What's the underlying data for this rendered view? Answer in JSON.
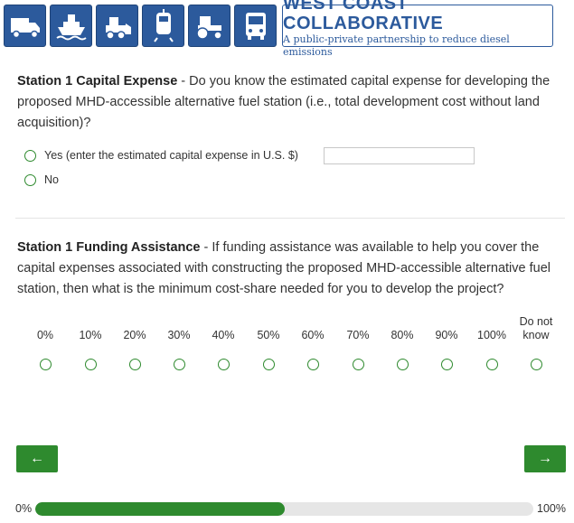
{
  "header": {
    "icons": [
      "truck-icon",
      "ship-icon",
      "loader-icon",
      "train-icon",
      "tractor-icon",
      "bus-icon"
    ],
    "logo_title": "WEST COAST COLLABORATIVE",
    "logo_subtitle": "A public-private partnership to reduce diesel emissions"
  },
  "question1": {
    "title": "Station 1 Capital Expense",
    "text": " - Do you know the estimated capital expense for developing the proposed MHD-accessible alternative fuel station (i.e., total development cost without land acquisition)?",
    "options": [
      {
        "label": "Yes (enter the estimated capital expense in U.S. $)"
      },
      {
        "label": "No"
      }
    ],
    "input_value": ""
  },
  "question2": {
    "title": "Station 1 Funding Assistance",
    "text": " - If funding assistance was available to help you cover the capital expenses associated with constructing the proposed MHD-accessible alternative fuel station, then what is the minimum cost-share needed for you to develop the project?",
    "scale": [
      "0%",
      "10%",
      "20%",
      "30%",
      "40%",
      "50%",
      "60%",
      "70%",
      "80%",
      "90%",
      "100%",
      "Do not\nknow"
    ]
  },
  "nav": {
    "back_label": "←",
    "next_label": "→"
  },
  "progress": {
    "start_label": "0%",
    "end_label": "100%",
    "value": 0.5
  },
  "colors": {
    "accent": "#2e8a2e",
    "brand": "#2c5a9c"
  }
}
